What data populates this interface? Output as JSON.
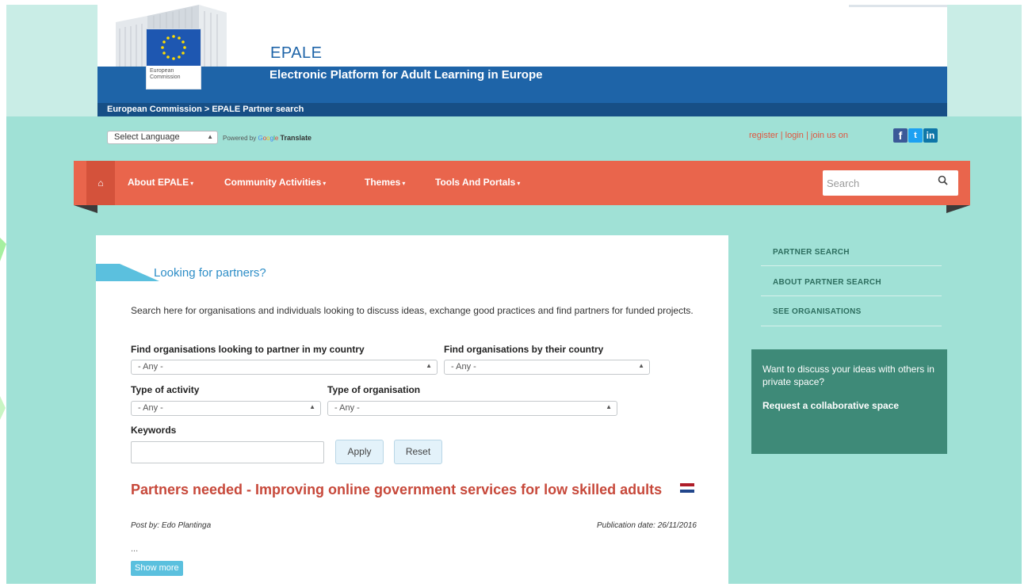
{
  "header": {
    "logo_line1": "European",
    "logo_line2": "Commission",
    "site_name": "EPALE",
    "tagline": "Electronic Platform for Adult Learning in Europe",
    "breadcrumb": "European Commission > EPALE Partner search"
  },
  "language": {
    "select_label": "Select Language",
    "powered_by": "Powered by",
    "google": "Google",
    "translate": "Translate"
  },
  "user_links": {
    "register": "register",
    "login": "login",
    "join": "join us on",
    "separator": "|"
  },
  "nav": {
    "items": [
      {
        "label": "About EPALE"
      },
      {
        "label": "Community Activities"
      },
      {
        "label": "Themes"
      },
      {
        "label": "Tools And Portals"
      }
    ],
    "search_placeholder": "Search"
  },
  "main": {
    "section_title": "Looking for partners?",
    "intro": "Search here for organisations and individuals looking to discuss ideas, exchange good practices and find partners for funded projects.",
    "filters": {
      "partner_country_label": "Find organisations looking to partner in my country",
      "partner_country_value": "- Any -",
      "org_country_label": "Find organisations by their country",
      "org_country_value": "- Any -",
      "activity_label": "Type of activity",
      "activity_value": "- Any -",
      "org_type_label": "Type of organisation",
      "org_type_value": "- Any -",
      "keywords_label": "Keywords",
      "keywords_value": ""
    },
    "apply_label": "Apply",
    "reset_label": "Reset",
    "article": {
      "title": "Partners needed - Improving online government services for low skilled adults",
      "author": "Post by: Edo Plantinga",
      "date": "Publication date: 26/11/2016",
      "excerpt": "...",
      "show_more": "Show more"
    }
  },
  "sidebar": {
    "links": [
      {
        "label": "PARTNER SEARCH"
      },
      {
        "label": "ABOUT PARTNER SEARCH"
      },
      {
        "label": "SEE ORGANISATIONS"
      }
    ],
    "collab_text": "Want to discuss your ideas with others in private space?",
    "collab_link": "Request a collaborative space"
  },
  "colors": {
    "page_bg": "#a0e1d6",
    "header_blue": "#1e64a8",
    "nav_orange": "#e9654c",
    "title_red": "#c7483a",
    "accent_blue": "#5bc0de",
    "sidebar_green": "#3e8a78"
  }
}
